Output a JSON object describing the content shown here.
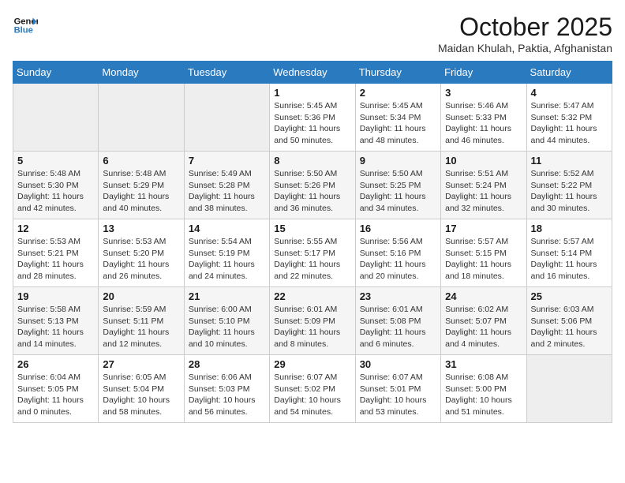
{
  "header": {
    "logo_line1": "General",
    "logo_line2": "Blue",
    "title": "October 2025",
    "subtitle": "Maidan Khulah, Paktia, Afghanistan"
  },
  "days_of_week": [
    "Sunday",
    "Monday",
    "Tuesday",
    "Wednesday",
    "Thursday",
    "Friday",
    "Saturday"
  ],
  "weeks": [
    [
      {
        "day": "",
        "info": ""
      },
      {
        "day": "",
        "info": ""
      },
      {
        "day": "",
        "info": ""
      },
      {
        "day": "1",
        "info": "Sunrise: 5:45 AM\nSunset: 5:36 PM\nDaylight: 11 hours\nand 50 minutes."
      },
      {
        "day": "2",
        "info": "Sunrise: 5:45 AM\nSunset: 5:34 PM\nDaylight: 11 hours\nand 48 minutes."
      },
      {
        "day": "3",
        "info": "Sunrise: 5:46 AM\nSunset: 5:33 PM\nDaylight: 11 hours\nand 46 minutes."
      },
      {
        "day": "4",
        "info": "Sunrise: 5:47 AM\nSunset: 5:32 PM\nDaylight: 11 hours\nand 44 minutes."
      }
    ],
    [
      {
        "day": "5",
        "info": "Sunrise: 5:48 AM\nSunset: 5:30 PM\nDaylight: 11 hours\nand 42 minutes."
      },
      {
        "day": "6",
        "info": "Sunrise: 5:48 AM\nSunset: 5:29 PM\nDaylight: 11 hours\nand 40 minutes."
      },
      {
        "day": "7",
        "info": "Sunrise: 5:49 AM\nSunset: 5:28 PM\nDaylight: 11 hours\nand 38 minutes."
      },
      {
        "day": "8",
        "info": "Sunrise: 5:50 AM\nSunset: 5:26 PM\nDaylight: 11 hours\nand 36 minutes."
      },
      {
        "day": "9",
        "info": "Sunrise: 5:50 AM\nSunset: 5:25 PM\nDaylight: 11 hours\nand 34 minutes."
      },
      {
        "day": "10",
        "info": "Sunrise: 5:51 AM\nSunset: 5:24 PM\nDaylight: 11 hours\nand 32 minutes."
      },
      {
        "day": "11",
        "info": "Sunrise: 5:52 AM\nSunset: 5:22 PM\nDaylight: 11 hours\nand 30 minutes."
      }
    ],
    [
      {
        "day": "12",
        "info": "Sunrise: 5:53 AM\nSunset: 5:21 PM\nDaylight: 11 hours\nand 28 minutes."
      },
      {
        "day": "13",
        "info": "Sunrise: 5:53 AM\nSunset: 5:20 PM\nDaylight: 11 hours\nand 26 minutes."
      },
      {
        "day": "14",
        "info": "Sunrise: 5:54 AM\nSunset: 5:19 PM\nDaylight: 11 hours\nand 24 minutes."
      },
      {
        "day": "15",
        "info": "Sunrise: 5:55 AM\nSunset: 5:17 PM\nDaylight: 11 hours\nand 22 minutes."
      },
      {
        "day": "16",
        "info": "Sunrise: 5:56 AM\nSunset: 5:16 PM\nDaylight: 11 hours\nand 20 minutes."
      },
      {
        "day": "17",
        "info": "Sunrise: 5:57 AM\nSunset: 5:15 PM\nDaylight: 11 hours\nand 18 minutes."
      },
      {
        "day": "18",
        "info": "Sunrise: 5:57 AM\nSunset: 5:14 PM\nDaylight: 11 hours\nand 16 minutes."
      }
    ],
    [
      {
        "day": "19",
        "info": "Sunrise: 5:58 AM\nSunset: 5:13 PM\nDaylight: 11 hours\nand 14 minutes."
      },
      {
        "day": "20",
        "info": "Sunrise: 5:59 AM\nSunset: 5:11 PM\nDaylight: 11 hours\nand 12 minutes."
      },
      {
        "day": "21",
        "info": "Sunrise: 6:00 AM\nSunset: 5:10 PM\nDaylight: 11 hours\nand 10 minutes."
      },
      {
        "day": "22",
        "info": "Sunrise: 6:01 AM\nSunset: 5:09 PM\nDaylight: 11 hours\nand 8 minutes."
      },
      {
        "day": "23",
        "info": "Sunrise: 6:01 AM\nSunset: 5:08 PM\nDaylight: 11 hours\nand 6 minutes."
      },
      {
        "day": "24",
        "info": "Sunrise: 6:02 AM\nSunset: 5:07 PM\nDaylight: 11 hours\nand 4 minutes."
      },
      {
        "day": "25",
        "info": "Sunrise: 6:03 AM\nSunset: 5:06 PM\nDaylight: 11 hours\nand 2 minutes."
      }
    ],
    [
      {
        "day": "26",
        "info": "Sunrise: 6:04 AM\nSunset: 5:05 PM\nDaylight: 11 hours\nand 0 minutes."
      },
      {
        "day": "27",
        "info": "Sunrise: 6:05 AM\nSunset: 5:04 PM\nDaylight: 10 hours\nand 58 minutes."
      },
      {
        "day": "28",
        "info": "Sunrise: 6:06 AM\nSunset: 5:03 PM\nDaylight: 10 hours\nand 56 minutes."
      },
      {
        "day": "29",
        "info": "Sunrise: 6:07 AM\nSunset: 5:02 PM\nDaylight: 10 hours\nand 54 minutes."
      },
      {
        "day": "30",
        "info": "Sunrise: 6:07 AM\nSunset: 5:01 PM\nDaylight: 10 hours\nand 53 minutes."
      },
      {
        "day": "31",
        "info": "Sunrise: 6:08 AM\nSunset: 5:00 PM\nDaylight: 10 hours\nand 51 minutes."
      },
      {
        "day": "",
        "info": ""
      }
    ]
  ]
}
